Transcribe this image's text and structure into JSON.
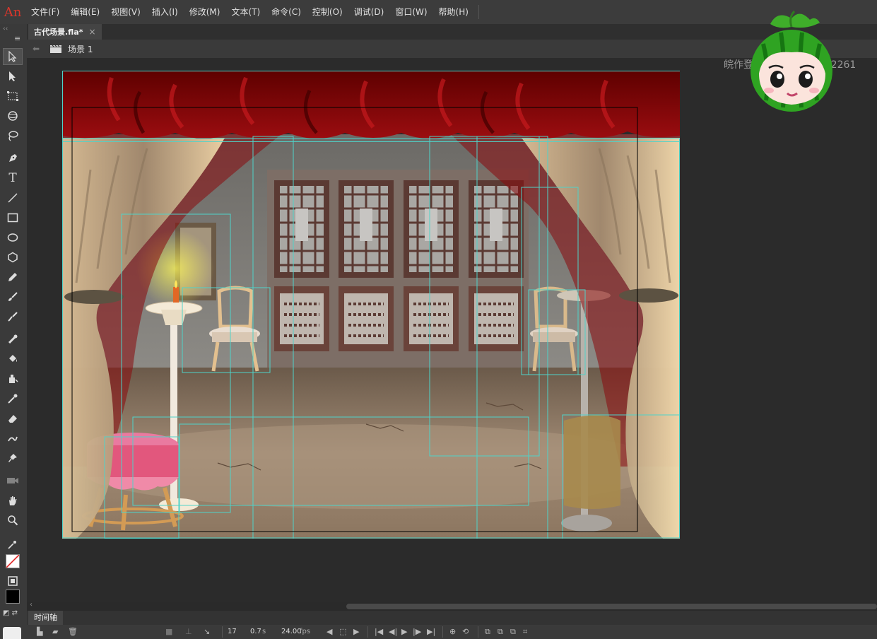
{
  "app": {
    "logo": "An"
  },
  "menu": {
    "items": [
      "文件(F)",
      "编辑(E)",
      "视图(V)",
      "插入(I)",
      "修改(M)",
      "文本(T)",
      "命令(C)",
      "控制(O)",
      "调试(D)",
      "窗口(W)",
      "帮助(H)"
    ]
  },
  "document_tab": {
    "title": "古代场景.fla*",
    "close": "×"
  },
  "breadcrumb": {
    "scene": "场景 1"
  },
  "watermark": {
    "text": "皖作登字-2023-A-00022261"
  },
  "timeline": {
    "tab_label": "时间轴",
    "frame": "17",
    "time": "0.7",
    "time_unit": "s",
    "fps": "24.00",
    "fps_unit": "fps"
  },
  "tools": [
    "selection-tool",
    "subselection-tool",
    "free-transform-tool",
    "3d-rotation-tool",
    "lasso-tool",
    "pen-tool",
    "text-tool",
    "line-tool",
    "rectangle-tool",
    "oval-tool",
    "polystar-tool",
    "pencil-tool",
    "paint-brush-tool",
    "brush-tool",
    "bone-tool",
    "paint-bucket-tool",
    "ink-bottle-tool",
    "eyedropper-tool",
    "eraser-tool",
    "width-tool",
    "pin-tool",
    "camera-tool",
    "hand-tool",
    "zoom-tool"
  ],
  "colors": {
    "accent_red": "#d9362b",
    "stage_bounding": "#4fd3c9",
    "curtain_red": "#8a0a0c",
    "ui_background": "#2b2b2b"
  }
}
